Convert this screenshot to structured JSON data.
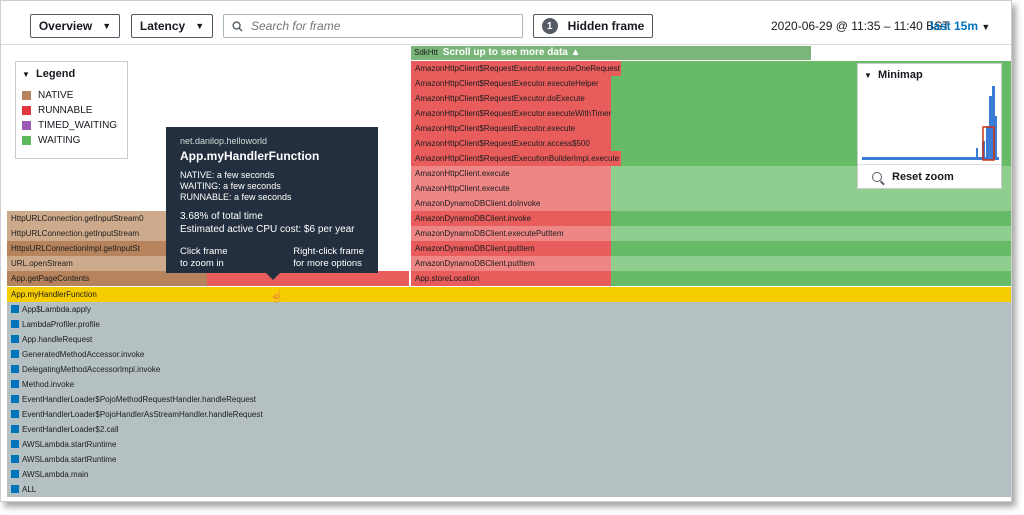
{
  "toolbar": {
    "view_select": "Overview",
    "metric_select": "Latency",
    "search_placeholder": "Search for frame",
    "hidden_count": "1",
    "hidden_label": "Hidden frame",
    "time_range": "2020-06-29 @ 11:35 – 11:40 BST",
    "range_preset": "last 15m"
  },
  "scroll_banner": {
    "prefix": "SdkHtt",
    "text": "Scroll up to see more data ▲"
  },
  "legend": {
    "title": "Legend",
    "items": [
      {
        "label": "NATIVE",
        "color": "#b7835d"
      },
      {
        "label": "RUNNABLE",
        "color": "#e0383e"
      },
      {
        "label": "TIMED_WAITING",
        "color": "#9b59b6"
      },
      {
        "label": "WAITING",
        "color": "#5cb85c"
      }
    ]
  },
  "minimap": {
    "title": "Minimap",
    "reset_label": "Reset zoom"
  },
  "tooltip": {
    "package": "net.danilop.helloworld",
    "function": "App.myHandlerFunction",
    "native": "NATIVE: a few seconds",
    "waiting": "WAITING: a few seconds",
    "runnable": "RUNNABLE: a few seconds",
    "total": "3.68% of total time",
    "cost": "Estimated active CPU cost: $6 per year",
    "hint_left_1": "Click frame",
    "hint_left_2": "to zoom in",
    "hint_right_1": "Right-click frame",
    "hint_right_2": "for more options"
  },
  "frames": {
    "f_r1": "AmazonHttpClient$RequestExecutor.executeOneRequest",
    "f_r2": "AmazonHttpClient$RequestExecutor.executeHelper",
    "f_r3": "AmazonHttpClient$RequestExecutor.doExecute",
    "f_r4": "AmazonHttpClient$RequestExecutor.executeWithTimer",
    "f_r5": "AmazonHttpClient$RequestExecutor.execute",
    "f_r6": "AmazonHttpClient$RequestExecutor.access$500",
    "f_r7": "AmazonHttpClient$RequestExecutionBuilderImpl.execute",
    "f_r8": "AmazonHttpClient.execute",
    "f_r9": "AmazonHttpClient.execute",
    "f_r10": "AmazonDynamoDBClient.doInvoke",
    "f_r11": "AmazonDynamoDBClient.invoke",
    "f_r12": "AmazonDynamoDBClient.executePutItem",
    "f_r13": "AmazonDynamoDBClient.putItem",
    "f_r14": "AmazonDynamoDBClient.putItem",
    "f_r15": "App.storeLocation",
    "f_l1": "HttpURLConnection.getInputStream0",
    "f_l2": "HttpURLConnection.getInputStream",
    "f_l3": "HttpsURLConnectionImpl.getInputSt",
    "f_l4": "URL.openStream",
    "f_l5": "App.getPageContents",
    "f_sel": "App.myHandlerFunction",
    "stack": [
      "App$Lambda.apply",
      "LambdaProfiler.profile",
      "App.handleRequest",
      "GeneratedMethodAccessor.invoke",
      "DelegatingMethodAccessorImpl.invoke",
      "Method.invoke",
      "EventHandlerLoader$PojoMethodRequestHandler.handleRequest",
      "EventHandlerLoader$PojoHandlerAsStreamHandler.handleRequest",
      "EventHandlerLoader$2.call",
      "AWSLambda.startRuntime",
      "AWSLambda.startRuntime",
      "AWSLambda.main",
      "ALL"
    ]
  }
}
